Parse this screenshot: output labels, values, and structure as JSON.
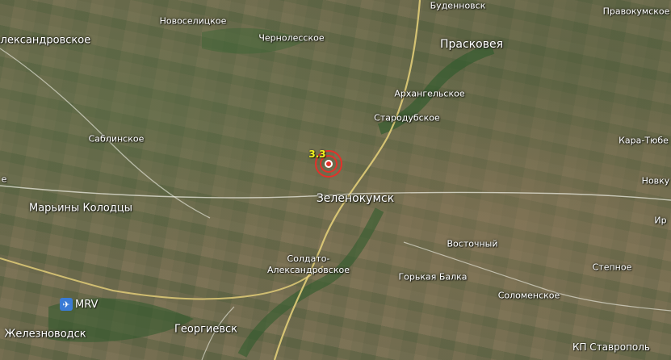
{
  "places": {
    "budennovsk": "Буденновск",
    "pravokumskoe": "Правокумское",
    "novoselitskoe": "Новоселицкое",
    "aleksandrovskoe": "Александровское",
    "chernolesskoe": "Чернолесское",
    "praskoveya": "Прасковея",
    "arkhangelskoe": "Архангельское",
    "starodubskoe": "Стародубское",
    "sablinskoe": "Саблинское",
    "kara_tyube": "Кара-Тюбе",
    "novkus": "Новку",
    "zelenokumsk": "Зеленокумск",
    "maryiny_kolodtsy": "Марьины Колодцы",
    "ir": "Ир",
    "vostochny": "Восточный",
    "soldato_1": "Солдато-",
    "soldato_2": "Александровское",
    "stepnoe": "Степное",
    "gorkaya_balka": "Горькая Балка",
    "solomenskoe": "Соломенское",
    "zheleznovodsk": "Железноводск",
    "georgievsk": "Георгиевск",
    "edge_e": "е"
  },
  "airport": {
    "code": "MRV",
    "icon": "airplane-icon",
    "color": "#3a7bd5"
  },
  "earthquake": {
    "magnitude": "3.3",
    "color": "#e3312a"
  },
  "credit": "КП Ставрополь"
}
